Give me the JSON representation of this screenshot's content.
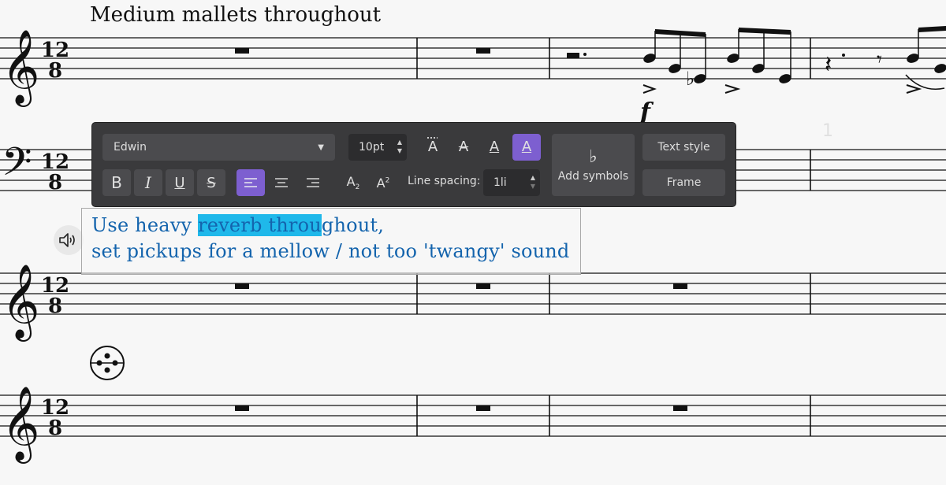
{
  "score": {
    "title_text": "Medium mallets throughout",
    "time_signature": "12/8",
    "dynamic": "f",
    "bar_number": "1"
  },
  "text_object": {
    "line1_before": "Use heavy ",
    "line1_selected": "reverb throu",
    "line1_after": "ghout,",
    "line2": "set pickups for a mellow / not too 'twangy' sound",
    "color": "#1464ad",
    "selection_color": "#1fb8ea"
  },
  "toolbar": {
    "font_family": "Edwin",
    "font_size": "10pt",
    "line_spacing_label": "Line spacing:",
    "line_spacing_value": "1li",
    "add_symbols_label": "Add symbols",
    "text_style_label": "Text style",
    "frame_label": "Frame",
    "bold_label": "B",
    "italic_label": "I",
    "underline_label": "U",
    "strike_label": "S",
    "subscript_label": "A",
    "superscript_label": "A",
    "active_color": "#7d5fd0"
  },
  "icons": [
    "speaker-icon",
    "chevron-down-icon",
    "align-left-icon",
    "align-center-icon",
    "align-right-icon",
    "flat-icon",
    "percussion-symbol-icon"
  ]
}
